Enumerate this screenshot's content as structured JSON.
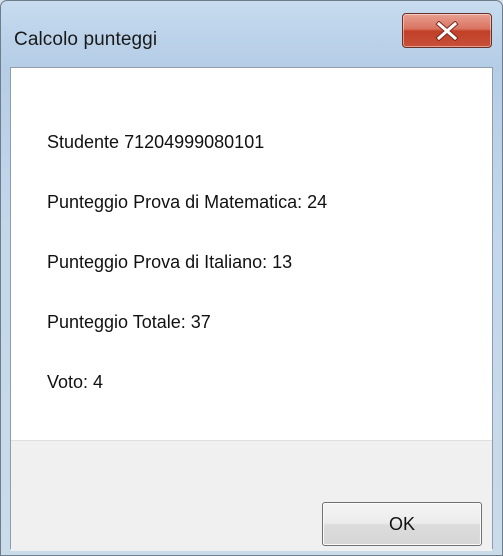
{
  "window": {
    "title": "Calcolo punteggi",
    "close_icon": "close-x-icon"
  },
  "message": {
    "student": "Studente 71204999080101",
    "math_score": "Punteggio Prova di Matematica: 24",
    "italian_score": "Punteggio Prova di Italiano: 13",
    "total_score": "Punteggio Totale: 37",
    "grade": "Voto: 4"
  },
  "buttons": {
    "ok_label": "OK"
  },
  "colors": {
    "close_button": "#c13f27",
    "dialog_background": "#ffffff",
    "footer_background": "#f0f0f0"
  }
}
